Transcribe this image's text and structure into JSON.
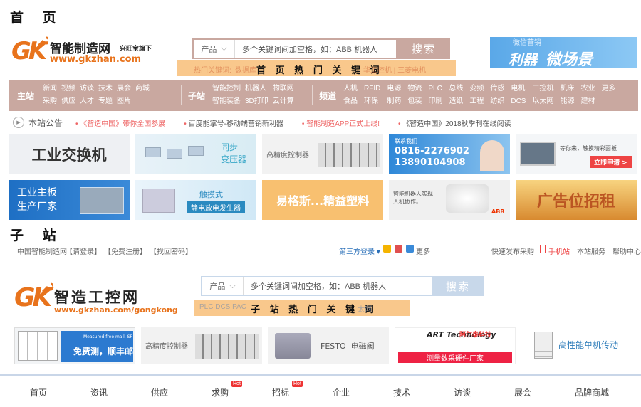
{
  "sections": {
    "home_title": "首 页",
    "sub_title": "子 站"
  },
  "home": {
    "logo": {
      "mark": "GK",
      "name": "智能制造网",
      "tagline": "兴旺宝旗下",
      "url": "www.gkzhan.com"
    },
    "search": {
      "category": "产品",
      "placeholder": "多个关键词间加空格，如：ABB 机器人",
      "button": "搜索"
    },
    "hot_keywords": {
      "prefix": "热门关键词:",
      "faint": "数据库",
      "overlay_label": "首 页 热 门 关 键 词",
      "faint_right": "华工控机 | 三菱电机"
    },
    "top_ad": {
      "line1": "微信营销",
      "line2a": "利器",
      "line2b": "微场景"
    },
    "nav": {
      "main": {
        "head": "主站",
        "items": [
          "新闻",
          "采购",
          "视频",
          "供应",
          "访谈",
          "人才",
          "技术",
          "专题",
          "展会",
          "图片",
          "商城"
        ]
      },
      "sub": {
        "head": "子站",
        "items": [
          "智能控制",
          "智能装备",
          "机器人",
          "3D打印",
          "物联网",
          "云计算"
        ]
      },
      "channel": {
        "head": "频道",
        "items": [
          "人机",
          "食品",
          "RFID",
          "环保",
          "电源",
          "制药",
          "物流",
          "包装",
          "PLC",
          "印刷",
          "总线",
          "造纸",
          "变频",
          "工程",
          "传感",
          "纺织",
          "电机",
          "DCS",
          "工控机",
          "以太网",
          "机床",
          "能源",
          "农业",
          "建材",
          "更多"
        ]
      }
    },
    "notice": {
      "icon": "speaker-icon",
      "title": "本站公告",
      "items": [
        "《智造中国》带你全国参展",
        "百度能掌号-移动端营销新利器",
        "智能制造APP正式上线!",
        "《智造中国》2018秋季刊在线阅读"
      ]
    },
    "ads_row1": [
      {
        "text": "工业交换机"
      },
      {
        "text": "同步\n变压器"
      },
      {
        "text": "高精度控制器"
      },
      {
        "text": "联系我们",
        "phone1": "0816-2276902",
        "phone2": "13890104908"
      },
      {
        "text": "等你来，触摸精彩面板",
        "cta": "立即申请 >"
      }
    ],
    "ads_row2": [
      {
        "text": "工业主板\n生产厂家"
      },
      {
        "text": "触摸式",
        "sub": "静电放电发生器"
      },
      {
        "text": "易格斯...精益塑料"
      },
      {
        "text": "智能机器人实现\n人机协作。",
        "brand": "ABB"
      },
      {
        "text": "广告位招租"
      }
    ]
  },
  "sub": {
    "topbar": {
      "left": [
        "中国智能制造网",
        "【请登录】",
        "【免费注册】",
        "【找回密码】"
      ],
      "third_party": "第三方登录",
      "more": "更多",
      "right": [
        "快速发布采购",
        "手机站",
        "本站服务",
        "帮助中心"
      ]
    },
    "logo": {
      "mark": "GK",
      "name": "智造工控网",
      "url": "www.gkzhan.com/gongkong"
    },
    "search": {
      "category": "产品",
      "placeholder": "多个关键词间加空格，如：ABB 机器人",
      "button": "搜索"
    },
    "hot_keywords": {
      "faint": "PLC  DCS  PAC",
      "overlay_label": "子 站 热 门 关 键 词",
      "faint_right": "太网"
    },
    "ads": [
      {
        "text": "免费测，顺丰邮",
        "small": "Measured free mail, SF"
      },
      {
        "text": "高精度控制器"
      },
      {
        "text": "FESTO  电磁阀"
      },
      {
        "text": "ART Technology",
        "cn": "阿尔泰科技",
        "sub": "测量数采硬件厂家"
      },
      {
        "text": "高性能单机传动"
      }
    ],
    "bottom_nav": [
      {
        "label": "首页"
      },
      {
        "label": "资讯"
      },
      {
        "label": "供应"
      },
      {
        "label": "求购",
        "badge": "Hot"
      },
      {
        "label": "招标",
        "badge": "Hot"
      },
      {
        "label": "企业"
      },
      {
        "label": "技术"
      },
      {
        "label": "访谈"
      },
      {
        "label": "展会"
      },
      {
        "label": "品牌商城"
      }
    ]
  },
  "colors": {
    "accent": "#e8731c",
    "nav_bg": "#c9a8a0",
    "hot_strip": "#f8be78",
    "link_blue": "#2a6fb8"
  }
}
